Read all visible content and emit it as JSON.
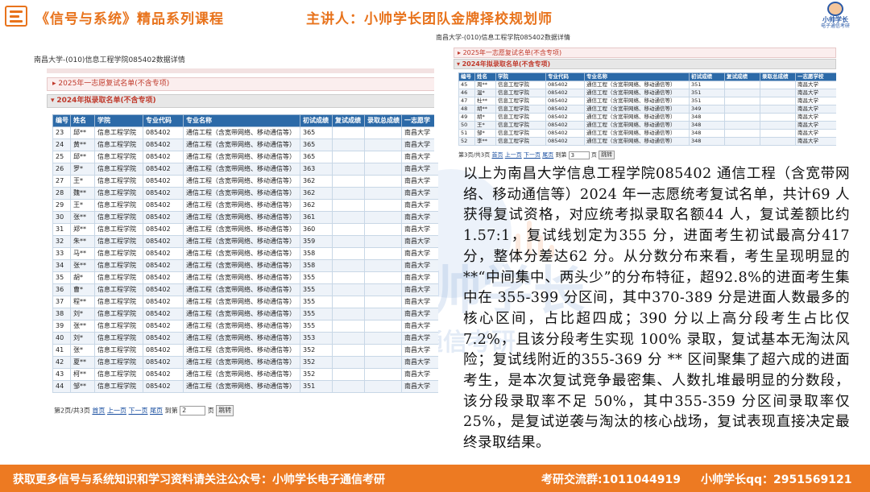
{
  "header": {
    "title": "《信号与系统》精品系列课程",
    "speaker": "主讲人：小帅学长团队金牌择校规划师",
    "logo_line1": "小帅学长",
    "logo_line2": "电子通信考研"
  },
  "shot_a": {
    "page_title": "南昌大学-(010)信息工程学院085402数据详情",
    "row_first_choice": "2025年一志愿复试名单(不含专项)",
    "row_admit": "2024年拟录取名单(不含专项)",
    "columns": [
      "编号",
      "姓名",
      "学院",
      "专业代码",
      "专业名称",
      "初试成绩",
      "复试成绩",
      "录取总成绩",
      "一志愿学"
    ],
    "rows": [
      [
        "23",
        "邱**",
        "信息工程学院",
        "085402",
        "通信工程（含宽带网络、移动通信等）",
        "365",
        "",
        "",
        "南昌大学"
      ],
      [
        "24",
        "黄**",
        "信息工程学院",
        "085402",
        "通信工程（含宽带网络、移动通信等）",
        "365",
        "",
        "",
        "南昌大学"
      ],
      [
        "25",
        "邱**",
        "信息工程学院",
        "085402",
        "通信工程（含宽带网络、移动通信等）",
        "365",
        "",
        "",
        "南昌大学"
      ],
      [
        "26",
        "罗*",
        "信息工程学院",
        "085402",
        "通信工程（含宽带网络、移动通信等）",
        "363",
        "",
        "",
        "南昌大学"
      ],
      [
        "27",
        "王*",
        "信息工程学院",
        "085402",
        "通信工程（含宽带网络、移动通信等）",
        "362",
        "",
        "",
        "南昌大学"
      ],
      [
        "28",
        "魏**",
        "信息工程学院",
        "085402",
        "通信工程（含宽带网络、移动通信等）",
        "362",
        "",
        "",
        "南昌大学"
      ],
      [
        "29",
        "王*",
        "信息工程学院",
        "085402",
        "通信工程（含宽带网络、移动通信等）",
        "362",
        "",
        "",
        "南昌大学"
      ],
      [
        "30",
        "张**",
        "信息工程学院",
        "085402",
        "通信工程（含宽带网络、移动通信等）",
        "361",
        "",
        "",
        "南昌大学"
      ],
      [
        "31",
        "郑**",
        "信息工程学院",
        "085402",
        "通信工程（含宽带网络、移动通信等）",
        "360",
        "",
        "",
        "南昌大学"
      ],
      [
        "32",
        "朱**",
        "信息工程学院",
        "085402",
        "通信工程（含宽带网络、移动通信等）",
        "359",
        "",
        "",
        "南昌大学"
      ],
      [
        "33",
        "马**",
        "信息工程学院",
        "085402",
        "通信工程（含宽带网络、移动通信等）",
        "358",
        "",
        "",
        "南昌大学"
      ],
      [
        "34",
        "张**",
        "信息工程学院",
        "085402",
        "通信工程（含宽带网络、移动通信等）",
        "358",
        "",
        "",
        "南昌大学"
      ],
      [
        "35",
        "胡*",
        "信息工程学院",
        "085402",
        "通信工程（含宽带网络、移动通信等）",
        "355",
        "",
        "",
        "南昌大学"
      ],
      [
        "36",
        "曹*",
        "信息工程学院",
        "085402",
        "通信工程（含宽带网络、移动通信等）",
        "355",
        "",
        "",
        "南昌大学"
      ],
      [
        "37",
        "程**",
        "信息工程学院",
        "085402",
        "通信工程（含宽带网络、移动通信等）",
        "355",
        "",
        "",
        "南昌大学"
      ],
      [
        "38",
        "刘*",
        "信息工程学院",
        "085402",
        "通信工程（含宽带网络、移动通信等）",
        "355",
        "",
        "",
        "南昌大学"
      ],
      [
        "39",
        "张**",
        "信息工程学院",
        "085402",
        "通信工程（含宽带网络、移动通信等）",
        "355",
        "",
        "",
        "南昌大学"
      ],
      [
        "40",
        "刘*",
        "信息工程学院",
        "085402",
        "通信工程（含宽带网络、移动通信等）",
        "353",
        "",
        "",
        "南昌大学"
      ],
      [
        "41",
        "张*",
        "信息工程学院",
        "085402",
        "通信工程（含宽带网络、移动通信等）",
        "352",
        "",
        "",
        "南昌大学"
      ],
      [
        "42",
        "夏**",
        "信息工程学院",
        "085402",
        "通信工程（含宽带网络、移动通信等）",
        "352",
        "",
        "",
        "南昌大学"
      ],
      [
        "43",
        "柯**",
        "信息工程学院",
        "085402",
        "通信工程（含宽带网络、移动通信等）",
        "352",
        "",
        "",
        "南昌大学"
      ],
      [
        "44",
        "邹**",
        "信息工程学院",
        "085402",
        "通信工程（含宽带网络、移动通信等）",
        "351",
        "",
        "",
        "南昌大学"
      ]
    ],
    "pager": {
      "status": "第2页/共3页",
      "first": "首页",
      "prev": "上一页",
      "next": "下一页",
      "last": "尾页",
      "goto": "到第",
      "page_value": "2",
      "page_unit": "页",
      "jump": "跳转"
    }
  },
  "shot_b": {
    "page_title": "南昌大学-(010)信息工程学院085402数据详情",
    "row_first_choice": "2025年一志愿复试名单(不含专项)",
    "row_admit": "2024年拟录取名单(不含专项)",
    "columns": [
      "编号",
      "姓名",
      "学院",
      "专业代码",
      "专业名称",
      "初试成绩",
      "复试成绩",
      "录取总成绩",
      "一志愿学校"
    ],
    "rows": [
      [
        "45",
        "周**",
        "信息工程学院",
        "085402",
        "通信工程（含宽带网络、移动通信等）",
        "351",
        "",
        "",
        "南昌大学"
      ],
      [
        "46",
        "温*",
        "信息工程学院",
        "085402",
        "通信工程（含宽带网络、移动通信等）",
        "351",
        "",
        "",
        "南昌大学"
      ],
      [
        "47",
        "杜**",
        "信息工程学院",
        "085402",
        "通信工程（含宽带网络、移动通信等）",
        "351",
        "",
        "",
        "南昌大学"
      ],
      [
        "48",
        "胡**",
        "信息工程学院",
        "085402",
        "通信工程（含宽带网络、移动通信等）",
        "349",
        "",
        "",
        "南昌大学"
      ],
      [
        "49",
        "胡*",
        "信息工程学院",
        "085402",
        "通信工程（含宽带网络、移动通信等）",
        "348",
        "",
        "",
        "南昌大学"
      ],
      [
        "50",
        "王*",
        "信息工程学院",
        "085402",
        "通信工程（含宽带网络、移动通信等）",
        "348",
        "",
        "",
        "南昌大学"
      ],
      [
        "51",
        "邹*",
        "信息工程学院",
        "085402",
        "通信工程（含宽带网络、移动通信等）",
        "348",
        "",
        "",
        "南昌大学"
      ],
      [
        "52",
        "李**",
        "信息工程学院",
        "085402",
        "通信工程（含宽带网络、移动通信等）",
        "348",
        "",
        "",
        "南昌大学"
      ]
    ],
    "pager": {
      "status": "第3页/共3页",
      "first": "首页",
      "prev": "上一页",
      "next": "下一页",
      "last": "尾页",
      "goto": "到第",
      "page_value": "3",
      "page_unit": "页",
      "jump": "跳转"
    }
  },
  "watermark": {
    "line1": "小帅学长",
    "line2": "电子通信考研"
  },
  "analysis": {
    "text": "以上为南昌大学信息工程学院085402 通信工程（含宽带网络、移动通信等）2024 年一志愿统考复试名单，共计69 人获得复试资格，对应统考拟录取名额44 人，复试差额比约1.57:1，复试线划定为355 分，进面考生初试最高分417 分，整体分差达62 分。从分数分布来看，考生呈现明显的 **“中间集中、两头少”的分布特征，超92.8%的进面考生集中在 355-399 分区间，其中370-389 分是进面人数最多的核心区间，占比超四成；390 分以上高分段考生占比仅7.2%，且该分段考生实现 100% 录取，复试基本无淘汰风险；复试线附近的355-369 分 ** 区间聚集了超六成的进面考生，是本次复试竞争最密集、人数扎堆最明显的分数段，该分段录取率不足 50%，其中355-359 分区间录取率仅 25%，是复试逆袭与淘汰的核心战场，复试表现直接决定最终录取结果。"
  },
  "footer": {
    "left": "获取更多信号与系统知识和学习资料请关注公众号：小帅学长电子通信考研",
    "mid": "考研交流群:1011044919",
    "right": "小帅学长qq：2951569121"
  },
  "colors": {
    "accent": "#e8731c",
    "footer_bg": "#ed7a22",
    "table_header": "#2c6aa8",
    "link": "#1a4fa0",
    "panel_red": "#c0392b"
  }
}
